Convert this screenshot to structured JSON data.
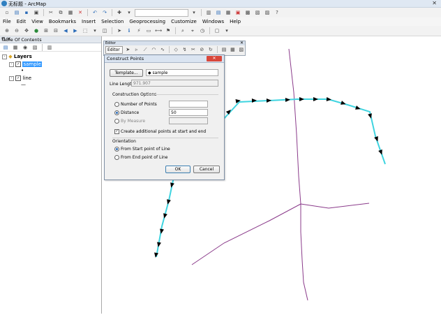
{
  "window": {
    "title": "无标题 - ArcMap",
    "close_glyph": "✕"
  },
  "menu": [
    "File",
    "Edit",
    "View",
    "Bookmarks",
    "Insert",
    "Selection",
    "Geoprocessing",
    "Customize",
    "Windows",
    "Help"
  ],
  "toc": {
    "title": "Table Of Contents",
    "root_label": "Layers",
    "layers": [
      {
        "name": "sample",
        "checked": true,
        "selected": true,
        "symbol": "•"
      },
      {
        "name": "line",
        "checked": true,
        "selected": false,
        "symbol": "—"
      }
    ]
  },
  "editor": {
    "title": "Editor",
    "menu_label": "Editor ▾"
  },
  "dialog": {
    "title": "Construct Points",
    "template_button": "Template...",
    "template_value": "sample",
    "line_length_label": "Line Length:",
    "line_length_value": "971.907",
    "construction_options_label": "Construction Options",
    "number_of_points_label": "Number of Points",
    "number_of_points_value": "",
    "distance_label": "Distance",
    "distance_value": "50",
    "by_measure_label": "By Measure",
    "by_measure_value": "",
    "selected_option": "distance",
    "additional_points_label": "Create additional points at start and end",
    "additional_points_checked": true,
    "orientation_label": "Orientation",
    "from_start_label": "From Start point of Line",
    "from_end_label": "From End point of Line",
    "orientation_selected": "start",
    "ok_label": "OK",
    "cancel_label": "Cancel"
  },
  "colors": {
    "selected_line": "#3fd4e0",
    "other_lines": "#8a3a8a",
    "arrow": "#000000",
    "selection_blue": "#3399ff"
  }
}
